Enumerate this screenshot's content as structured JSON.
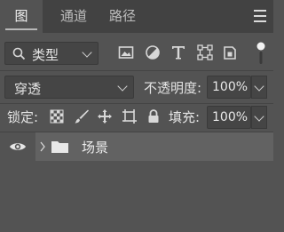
{
  "tabs": [
    {
      "label": "图层",
      "active": true
    },
    {
      "label": "通道",
      "active": false
    },
    {
      "label": "路径",
      "active": false
    }
  ],
  "filter": {
    "kind_label": "类型",
    "icons": [
      "image-filter-icon",
      "adjustment-filter-icon",
      "text-filter-icon",
      "shape-filter-icon",
      "smart-object-filter-icon"
    ]
  },
  "blend": {
    "mode": "穿透",
    "opacity_label": "不透明度:",
    "opacity_value": "100%"
  },
  "lock": {
    "label": "锁定:",
    "icons": [
      "lock-transparent-pixels-icon",
      "lock-image-pixels-icon",
      "lock-position-icon",
      "lock-artboard-icon",
      "lock-all-icon"
    ],
    "fill_label": "填充:",
    "fill_value": "100%"
  },
  "layers": [
    {
      "name": "场景",
      "type": "group",
      "visible": true,
      "expanded": false
    }
  ],
  "colors": {
    "panel": "#535353",
    "tabbar": "#424242",
    "selected_row": "#626262"
  }
}
